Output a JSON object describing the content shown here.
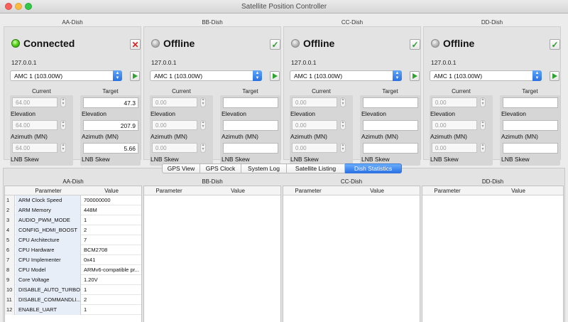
{
  "window": {
    "title": "Satellite Position Controller"
  },
  "dishes": [
    {
      "name": "AA-Dish",
      "status": "Connected",
      "ip": "127.0.0.1",
      "satellite": "AMC 1 (103.00W)",
      "current_header": "Current",
      "target_header": "Target",
      "current": {
        "elevation": "64.00",
        "azimuth": "64.00",
        "lnb_skew": "64.00"
      },
      "target": {
        "elevation": "47.3",
        "azimuth": "207.9",
        "lnb_skew": "5.66"
      },
      "labels": {
        "elevation": "Elevation",
        "azimuth": "Azimuth (MN)",
        "lnb_skew": "LNB Skew"
      }
    },
    {
      "name": "BB-Dish",
      "status": "Offline",
      "ip": "127.0.0.1",
      "satellite": "AMC 1 (103.00W)",
      "current_header": "Current",
      "target_header": "Target",
      "current": {
        "elevation": "0.00",
        "azimuth": "0.00",
        "lnb_skew": "0.00"
      },
      "target": {
        "elevation": "",
        "azimuth": "",
        "lnb_skew": ""
      },
      "labels": {
        "elevation": "Elevation",
        "azimuth": "Azimuth (MN)",
        "lnb_skew": "LNB Skew"
      }
    },
    {
      "name": "CC-Dish",
      "status": "Offline",
      "ip": "127.0.0.1",
      "satellite": "AMC 1 (103.00W)",
      "current_header": "Current",
      "target_header": "Target",
      "current": {
        "elevation": "0.00",
        "azimuth": "0.00",
        "lnb_skew": "0.00"
      },
      "target": {
        "elevation": "",
        "azimuth": "",
        "lnb_skew": ""
      },
      "labels": {
        "elevation": "Elevation",
        "azimuth": "Azimuth (MN)",
        "lnb_skew": "LNB Skew"
      }
    },
    {
      "name": "DD-Dish",
      "status": "Offline",
      "ip": "127.0.0.1",
      "satellite": "AMC 1 (103.00W)",
      "current_header": "Current",
      "target_header": "Target",
      "current": {
        "elevation": "0.00",
        "azimuth": "0.00",
        "lnb_skew": "0.00"
      },
      "target": {
        "elevation": "",
        "azimuth": "",
        "lnb_skew": ""
      },
      "labels": {
        "elevation": "Elevation",
        "azimuth": "Azimuth (MN)",
        "lnb_skew": "LNB Skew"
      }
    }
  ],
  "tabs": [
    {
      "label": "GPS View",
      "active": false
    },
    {
      "label": "GPS Clock",
      "active": false
    },
    {
      "label": "System Log",
      "active": false
    },
    {
      "label": "Satellite Listing",
      "active": false
    },
    {
      "label": "Dish Statistics",
      "active": true
    }
  ],
  "stats": {
    "headers": {
      "parameter": "Parameter",
      "value": "Value"
    },
    "tables": [
      {
        "name": "AA-Dish",
        "rows": [
          {
            "n": "1",
            "param": "ARM Clock Speed",
            "value": "700000000"
          },
          {
            "n": "2",
            "param": "ARM Memory",
            "value": "448M"
          },
          {
            "n": "3",
            "param": "AUDIO_PWM_MODE",
            "value": "1"
          },
          {
            "n": "4",
            "param": "CONFIG_HDMI_BOOST",
            "value": "2"
          },
          {
            "n": "5",
            "param": "CPU Architecture",
            "value": "7"
          },
          {
            "n": "6",
            "param": "CPU Hardware",
            "value": "BCM2708"
          },
          {
            "n": "7",
            "param": "CPU Implementer",
            "value": "0x41"
          },
          {
            "n": "8",
            "param": "CPU Model",
            "value": "ARMv6-compatible pr..."
          },
          {
            "n": "9",
            "param": "Core Voltage",
            "value": "1.20V"
          },
          {
            "n": "10",
            "param": "DISABLE_AUTO_TURBO",
            "value": "1"
          },
          {
            "n": "11",
            "param": "DISABLE_COMMANDLI...",
            "value": "2"
          },
          {
            "n": "12",
            "param": "ENABLE_UART",
            "value": "1"
          }
        ]
      },
      {
        "name": "BB-Dish",
        "rows": []
      },
      {
        "name": "CC-Dish",
        "rows": []
      },
      {
        "name": "DD-Dish",
        "rows": []
      }
    ]
  },
  "icons": {
    "connected": "green-led-icon",
    "offline": "gray-led-icon",
    "disconnect": "red-x-icon",
    "connect": "green-check-icon",
    "send": "play-icon"
  }
}
